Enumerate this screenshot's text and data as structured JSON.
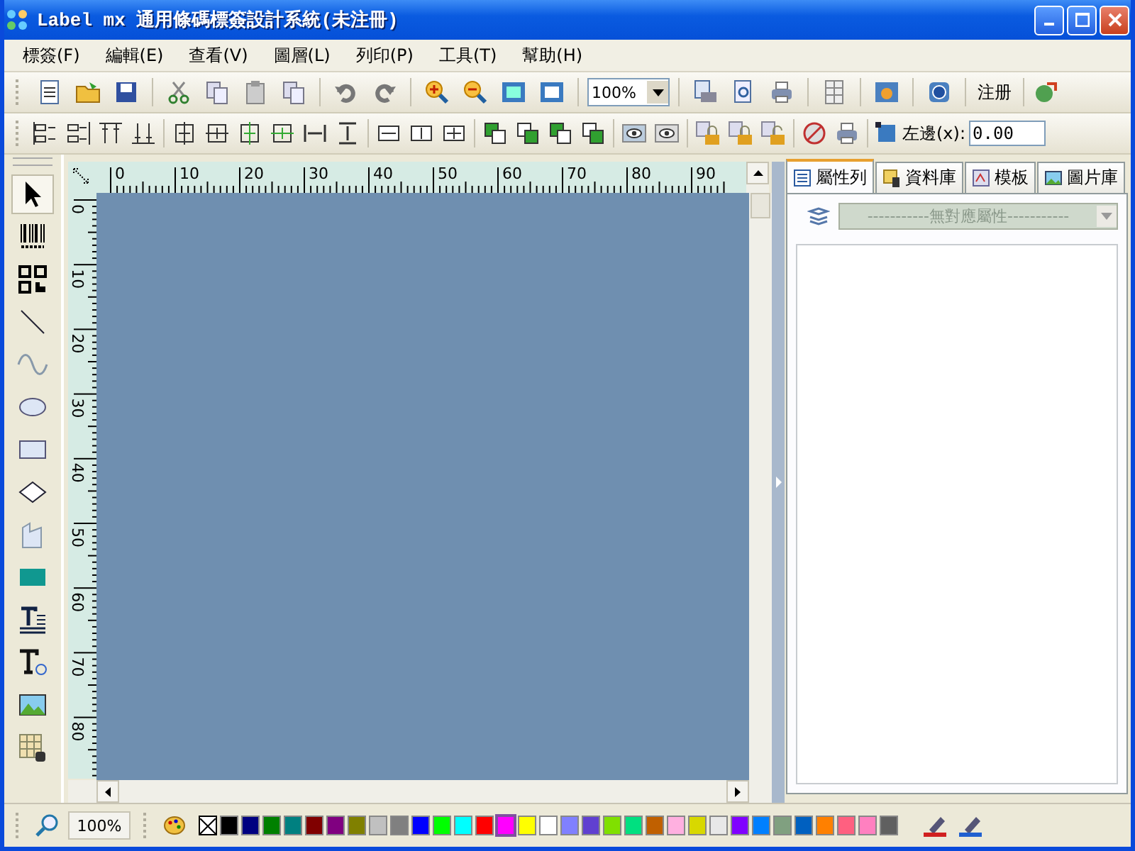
{
  "window": {
    "title": "Label mx 通用條碼標簽設計系統(未注冊)"
  },
  "menu": [
    "標簽(F)",
    "編輯(E)",
    "查看(V)",
    "圖層(L)",
    "列印(P)",
    "工具(T)",
    "幫助(H)"
  ],
  "toolbar": {
    "zoom": "100%",
    "register": "注册"
  },
  "layout_bar": {
    "label": "左邊(x):",
    "value": "0.00"
  },
  "tools": [
    {
      "selected": true
    },
    {
      "selected": false
    },
    {
      "selected": false
    },
    {
      "selected": false
    },
    {
      "selected": false
    },
    {
      "selected": false
    },
    {
      "selected": false
    },
    {
      "selected": false
    },
    {
      "selected": false
    },
    {
      "selected": false
    },
    {
      "selected": false
    },
    {
      "selected": false
    },
    {
      "selected": false
    },
    {
      "selected": false
    }
  ],
  "ruler": {
    "horizontal": [
      "0",
      "10",
      "20",
      "30",
      "40",
      "50",
      "60",
      "70",
      "80",
      "90"
    ],
    "vertical": [
      "0",
      "10",
      "20",
      "30",
      "40",
      "50",
      "60",
      "70",
      "80"
    ]
  },
  "panel": {
    "tabs": [
      {
        "label": "屬性列",
        "selected": true
      },
      {
        "label": "資料庫",
        "selected": false
      },
      {
        "label": "模板",
        "selected": false
      },
      {
        "label": "圖片庫",
        "selected": false
      }
    ],
    "property_select": {
      "placeholder": "-----------無對應屬性-----------"
    }
  },
  "status_bar": {
    "zoom": "100%",
    "swatches": [
      {
        "kind": "none",
        "selected": false
      },
      {
        "kind": "color",
        "color": "#000000",
        "selected": false
      },
      {
        "kind": "color",
        "color": "#000080",
        "selected": false
      },
      {
        "kind": "color",
        "color": "#008000",
        "selected": false
      },
      {
        "kind": "color",
        "color": "#008080",
        "selected": false
      },
      {
        "kind": "color",
        "color": "#800000",
        "selected": false
      },
      {
        "kind": "color",
        "color": "#800080",
        "selected": false
      },
      {
        "kind": "color",
        "color": "#808000",
        "selected": false
      },
      {
        "kind": "color",
        "color": "#c0c0c0",
        "selected": false
      },
      {
        "kind": "color",
        "color": "#808080",
        "selected": false
      },
      {
        "kind": "color",
        "color": "#0000ff",
        "selected": false
      },
      {
        "kind": "color",
        "color": "#00ff00",
        "selected": false
      },
      {
        "kind": "color",
        "color": "#00ffff",
        "selected": false
      },
      {
        "kind": "color",
        "color": "#ff0000",
        "selected": false
      },
      {
        "kind": "color",
        "color": "#ff00ff",
        "selected": true
      },
      {
        "kind": "color",
        "color": "#ffff00",
        "selected": false
      },
      {
        "kind": "color",
        "color": "#ffffff",
        "selected": false
      },
      {
        "kind": "color",
        "color": "#8080ff",
        "selected": false
      },
      {
        "kind": "color",
        "color": "#6040d0",
        "selected": false
      },
      {
        "kind": "color",
        "color": "#80e000",
        "selected": false
      },
      {
        "kind": "color",
        "color": "#00e080",
        "selected": false
      },
      {
        "kind": "color",
        "color": "#c06000",
        "selected": false
      },
      {
        "kind": "color",
        "color": "#ffb0e0",
        "selected": false
      },
      {
        "kind": "color",
        "color": "#d8d800",
        "selected": false
      },
      {
        "kind": "color",
        "color": "#e8e8e8",
        "selected": false
      },
      {
        "kind": "color",
        "color": "#8000ff",
        "selected": false
      },
      {
        "kind": "color",
        "color": "#0080ff",
        "selected": false
      },
      {
        "kind": "color",
        "color": "#80a080",
        "selected": false
      },
      {
        "kind": "color",
        "color": "#0060c0",
        "selected": false
      },
      {
        "kind": "color",
        "color": "#ff8000",
        "selected": false
      },
      {
        "kind": "color",
        "color": "#ff6080",
        "selected": false
      },
      {
        "kind": "color",
        "color": "#ff80c0",
        "selected": false
      },
      {
        "kind": "color",
        "color": "#606060",
        "selected": false
      }
    ]
  }
}
